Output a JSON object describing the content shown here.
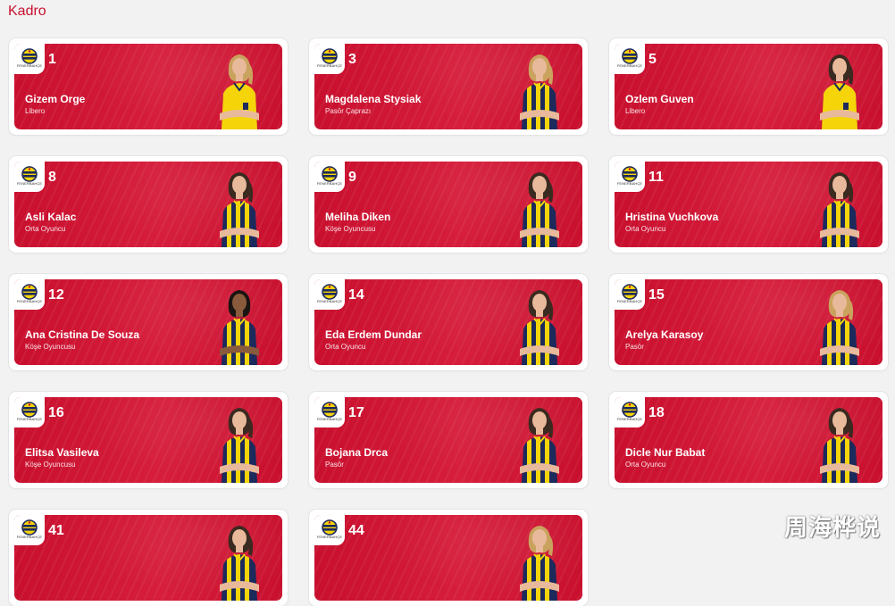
{
  "page": {
    "title": "Kadro"
  },
  "club_logo_text": "FENERBAHÇE",
  "colors": {
    "card_red": "#c8102e",
    "navy": "#1c2a5c",
    "yellow": "#f5d50a"
  },
  "players": [
    {
      "number": "1",
      "name": "Gizem Orge",
      "position": "Libero",
      "kit": "yellow",
      "hair": "blonde"
    },
    {
      "number": "3",
      "name": "Magdalena Stysiak",
      "position": "Pasör Çaprazı",
      "kit": "stripes",
      "hair": "blonde"
    },
    {
      "number": "5",
      "name": "Ozlem Guven",
      "position": "Libero",
      "kit": "yellow",
      "hair": "dark"
    },
    {
      "number": "8",
      "name": "Asli Kalac",
      "position": "Orta Oyuncu",
      "kit": "stripes",
      "hair": "dark"
    },
    {
      "number": "9",
      "name": "Meliha Diken",
      "position": "Köşe Oyuncusu",
      "kit": "stripes",
      "hair": "dark"
    },
    {
      "number": "11",
      "name": "Hristina Vuchkova",
      "position": "Orta Oyuncu",
      "kit": "stripes",
      "hair": "dark"
    },
    {
      "number": "12",
      "name": "Ana Cristina De Souza",
      "position": "Köşe Oyuncusu",
      "kit": "stripes",
      "hair": "black"
    },
    {
      "number": "14",
      "name": "Eda Erdem Dundar",
      "position": "Orta Oyuncu",
      "kit": "stripes",
      "hair": "dark"
    },
    {
      "number": "15",
      "name": "Arelya Karasoy",
      "position": "Pasör",
      "kit": "stripes",
      "hair": "blonde"
    },
    {
      "number": "16",
      "name": "Elitsa Vasileva",
      "position": "Köşe Oyuncusu",
      "kit": "stripes",
      "hair": "dark"
    },
    {
      "number": "17",
      "name": "Bojana Drca",
      "position": "Pasör",
      "kit": "stripes",
      "hair": "dark"
    },
    {
      "number": "18",
      "name": "Dicle Nur Babat",
      "position": "Orta Oyuncu",
      "kit": "stripes",
      "hair": "dark"
    },
    {
      "number": "41",
      "name": "",
      "position": "",
      "kit": "stripes",
      "hair": "dark"
    },
    {
      "number": "44",
      "name": "",
      "position": "",
      "kit": "stripes",
      "hair": "blonde"
    }
  ],
  "watermark": "周海桦说"
}
